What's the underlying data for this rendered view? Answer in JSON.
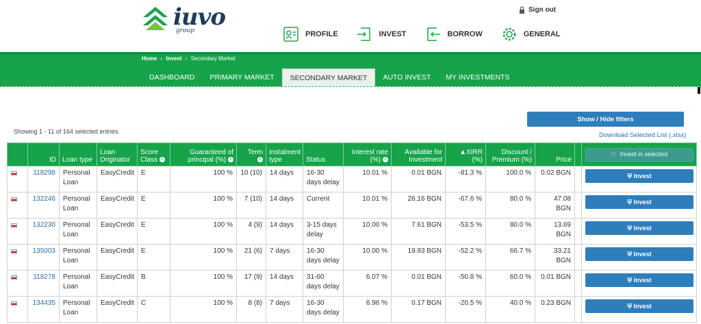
{
  "header": {
    "logo_word": "iuvo",
    "logo_sub": "group",
    "signout": "Sign out",
    "nav": [
      "PROFILE",
      "INVEST",
      "BORROW",
      "GENERAL"
    ]
  },
  "breadcrumb": [
    "Home",
    "Invest",
    "Secondary Market"
  ],
  "subnav": [
    "DASHBOARD",
    "PRIMARY MARKET",
    "SECONDARY MARKET",
    "AUTO INVEST",
    "MY INVESTMENTS"
  ],
  "filters_button": "Show / Hide filters",
  "download_link": "Download Selected List (.xlsx)",
  "showing_text": "Showing 1 - 11 of 164 selected entries.",
  "invest_selected_label": "Invest in selected",
  "invest_label": "Invest",
  "columns": {
    "id": "ID",
    "loan_type": "Loan type",
    "originator": "Loan Originator",
    "score": "Score Class",
    "guaranteed": "Guaranteed of principal (%)",
    "term": "Term",
    "instalment": "Instalment type",
    "status": "Status",
    "interest": "Interest rate (%)",
    "available": "Available for Investment",
    "xirr": "▲XIRR (%)",
    "discount": "Discount / Premium (%)",
    "price": "Price"
  },
  "rows": [
    {
      "id": "118298",
      "loan_type": "Personal Loan",
      "originator": "EasyCredit",
      "score": "E",
      "guaranteed": "100 %",
      "term": "10 (10)",
      "instalment": "14 days",
      "status": "16-30 days delay",
      "interest": "10.01 %",
      "available": "0.01 BGN",
      "xirr": "-81.3 %",
      "discount": "100.0 %",
      "price": "0.02 BGN"
    },
    {
      "id": "132246",
      "loan_type": "Personal Loan",
      "originator": "EasyCredit",
      "score": "E",
      "guaranteed": "100 %",
      "term": "7 (10)",
      "instalment": "14 days",
      "status": "Current",
      "interest": "10.01 %",
      "available": "26.16 BGN",
      "xirr": "-67.6 %",
      "discount": "80.0 %",
      "price": "47.08 BGN"
    },
    {
      "id": "132230",
      "loan_type": "Personal Loan",
      "originator": "EasyCredit",
      "score": "E",
      "guaranteed": "100 %",
      "term": "4 (9)",
      "instalment": "14 days",
      "status": "3-15 days delay",
      "interest": "10.00 %",
      "available": "7.61 BGN",
      "xirr": "-53.5 %",
      "discount": "80.0 %",
      "price": "13.69 BGN"
    },
    {
      "id": "135003",
      "loan_type": "Personal Loan",
      "originator": "EasyCredit",
      "score": "E",
      "guaranteed": "100 %",
      "term": "21 (6)",
      "instalment": "7 days",
      "status": "16-30 days delay",
      "interest": "10.00 %",
      "available": "19.93 BGN",
      "xirr": "-52.2 %",
      "discount": "66.7 %",
      "price": "33.21 BGN"
    },
    {
      "id": "118278",
      "loan_type": "Personal Loan",
      "originator": "EasyCredit",
      "score": "B",
      "guaranteed": "100 %",
      "term": "17 (9)",
      "instalment": "14 days",
      "status": "31-60 days delay",
      "interest": "6.07 %",
      "available": "0.01 BGN",
      "xirr": "-50.8 %",
      "discount": "60.0 %",
      "price": "0.01 BGN"
    },
    {
      "id": "134435",
      "loan_type": "Personal Loan",
      "originator": "EasyCredit",
      "score": "C",
      "guaranteed": "100 %",
      "term": "8 (8)",
      "instalment": "7 days",
      "status": "16-30 days delay",
      "interest": "6.96 %",
      "available": "0.17 BGN",
      "xirr": "-20.5 %",
      "discount": "40.0 %",
      "price": "0.23 BGN"
    }
  ],
  "colors": {
    "brand_green": "#16a34a",
    "button_blue": "#2f7ebc",
    "logo_navy": "#1e3c5a"
  }
}
